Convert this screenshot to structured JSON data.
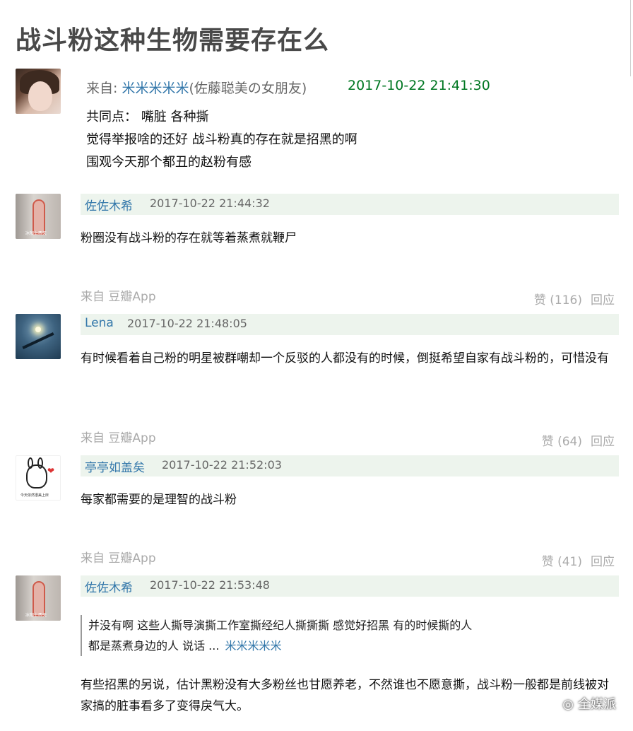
{
  "page": {
    "title": "战斗粉这种生物需要存在么"
  },
  "post": {
    "from_label": "来自:",
    "author": "米米米米米",
    "author_suffix": "(佐藤聪美の女朋友)",
    "timestamp": "2017-10-22 21:41:30",
    "lines": [
      "共同点： 嘴脏 各种撕",
      "觉得举报啥的还好 战斗粉真的存在就是招黑的啊",
      "围观今天那个都丑的赵粉有感"
    ]
  },
  "comments": [
    {
      "user": "佐佐木希",
      "time": "2017-10-22 21:44:32",
      "text": "粉圈没有战斗粉的存在就等着蒸煮就鞭尸",
      "source": "来自 豆瓣App",
      "like": "赞 (116)",
      "reply": "回应"
    },
    {
      "user": "Lena",
      "time": "2017-10-22 21:48:05",
      "text": "有时候看着自己粉的明星被群嘲却一个反驳的人都没有的时候，倒挺希望自家有战斗粉的，可惜没有",
      "source": "来自 豆瓣App",
      "like": "赞 (64)",
      "reply": "回应"
    },
    {
      "user": "亭亭如盖矣",
      "time": "2017-10-22 21:52:03",
      "text": "每家都需要的是理智的战斗粉",
      "source": "来自 豆瓣App",
      "like": "赞 (41)",
      "reply": "回应"
    },
    {
      "user": "佐佐木希",
      "time": "2017-10-22 21:53:48",
      "quote": "并没有啊 这些人撕导演撕工作室撕经纪人撕撕撕 感觉好招黑 有的时候撕的人都是蒸煮身边的人 说话 ...",
      "quote_author": "米米米米米",
      "text": "有些招黑的另说，估计黑粉没有大多粉丝也甘愿养老，不然谁也不愿意撕，战斗粉一般都是前线被对家搞的脏事看多了变得戾气大。"
    }
  ],
  "avatar_captions": {
    "a2": "冰咖上西天",
    "a4": "今天依然很美上床"
  },
  "watermark": {
    "text": "全媒派",
    "icon": "wechat-icon"
  },
  "colors": {
    "link": "#3377aa",
    "timestamp_green": "#007722",
    "bar_bg": "#edf4ed",
    "meta_grey": "#aaaaaa"
  }
}
